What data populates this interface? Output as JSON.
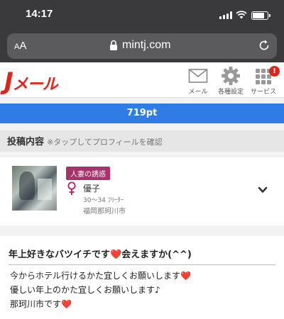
{
  "status_bar": {
    "time": "14:17",
    "battery_level": 0.8
  },
  "browser": {
    "text_size_label": "AA",
    "url": "mintj.com"
  },
  "site": {
    "logo_big": "J",
    "logo_small": "メール",
    "nav": [
      {
        "label": "メール",
        "icon": "envelope-icon"
      },
      {
        "label": "各種設定",
        "icon": "gear-icon"
      },
      {
        "label": "サービス",
        "icon": "grid-icon",
        "badge": "!"
      }
    ],
    "brand_color": "#e2231a"
  },
  "points": {
    "value": "719pt",
    "bar_color": "#2f7ce6"
  },
  "section": {
    "title": "投稿内容",
    "note": "※タップしてプロフィールを確認"
  },
  "profile": {
    "tag": "人妻の誘惑",
    "name": "優子",
    "age_job": "30～34 ﾌﾘｰﾀｰ",
    "location": "福岡那珂川市"
  },
  "post": {
    "title": "年上好きなバツイチです❤️会えますか(^^)",
    "lines": [
      "今からホテル行けるかた宜しくお願いします❤️",
      "優しい年上のかた宜しくお願いします♪",
      "那珂川市です❤️"
    ]
  }
}
